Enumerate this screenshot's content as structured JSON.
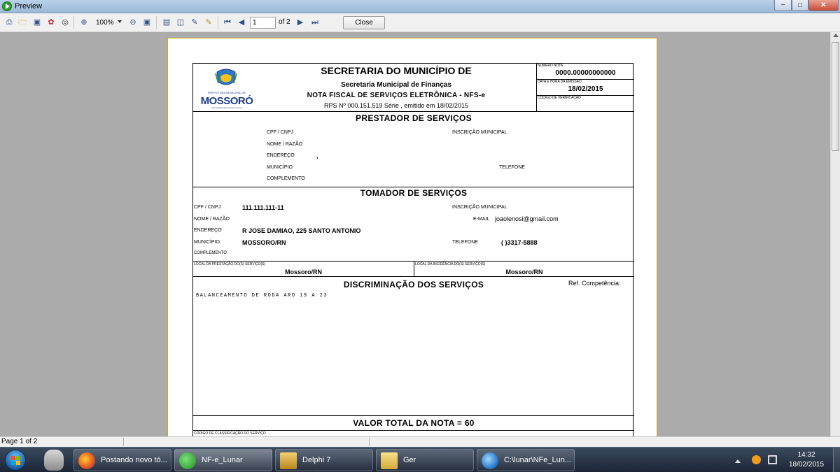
{
  "window": {
    "title": "Preview",
    "min": "−",
    "max": "□",
    "close": "✕"
  },
  "toolbar": {
    "zoom": "100%",
    "page_current": "1",
    "page_total": "of 2",
    "close_label": "Close"
  },
  "doc": {
    "header": {
      "title": "SECRETARIA DO MUNICÍPIO DE",
      "sub1": "Secretaria Municipal de Finanças",
      "sub2": "NOTA FISCAL DE SERVIÇOS ELETRÔNICA - NFS-e",
      "sub3": "RPS Nº 000.151.519 Série , emitido em 18/02/2015",
      "logo_text": "MOSSORÓ",
      "logo_small": "PREFEITURA MUNICIPAL DE",
      "logo_under": "www.prefeiturademossoro.com.br",
      "numero_label": "NÚMERO NOTA",
      "numero_value": "0000.00000000000",
      "data_label": "DATA E HORA DA EMISSÃO",
      "data_value": "18/02/2015",
      "codigo_label": "CÓDIGO DE VERIFICAÇÃO"
    },
    "prestador": {
      "title": "PRESTADOR DE SERVIÇOS",
      "cpf_label": "CPF / CNPJ",
      "nome_label": "NOME / RAZÃO",
      "endereco_label": "ENDEREÇO",
      "endereco_value": ",",
      "municipio_label": "MUNICÍPIO",
      "complemento_label": "COMPLEMENTO",
      "inscricao_label": "INSCRIÇÃO MUNICIPAL",
      "telefone_label": "TELEFONE"
    },
    "tomador": {
      "title": "TOMADOR DE SERVIÇOS",
      "cpf_label": "CPF / CNPJ",
      "cpf_value": "111.111.111-11",
      "nome_label": "NOME / RAZÃO",
      "endereco_label": "ENDEREÇO",
      "endereco_value": "R JOSE DAMIAO, 225 SANTO ANTONIO",
      "municipio_label": "MUNICÍPIO",
      "municipio_value": "MOSSORO/RN",
      "complemento_label": "COMPLEMENTO",
      "inscricao_label": "INSCRIÇÃO MUNICIPAL",
      "email_label": "E-MAIL",
      "email_value": "joaolenosi@gmail.com",
      "telefone_label": "TELEFONE",
      "telefone_value": "(    )3317-5888"
    },
    "local": {
      "prestacao_label": "LOCAL DA PRESTAÇÃO DO(S) SERVIÇO(S)",
      "prestacao_value": "Mossoro/RN",
      "incidencia_label": "LOCAL DA INCIDÊNCIA DO(S) SERVIÇO(S)",
      "incidencia_value": "Mossoro/RN"
    },
    "discriminacao": {
      "title": "DISCRIMINAÇÃO DOS SERVIÇOS",
      "ref_label": "Ref. Competência:",
      "text": "BALANCEAMENTO DE RODA ARO 19 A 23"
    },
    "total": {
      "label": "VALOR TOTAL DA NOTA = 60"
    },
    "classificacao_label": "CÓDIGO DE CLASSIFICAÇÃO DO SERVIÇO"
  },
  "statusbar": {
    "page": "Page 1 of 2"
  },
  "taskbar": {
    "items": [
      {
        "label": "Postando novo tó..."
      },
      {
        "label": "NF-e_Lunar"
      },
      {
        "label": "Delphi 7"
      },
      {
        "label": "Ger"
      },
      {
        "label": "C:\\lunar\\NFe_Lun..."
      }
    ],
    "clock_time": "14:32",
    "clock_date": "18/02/2015"
  },
  "colors": {
    "accent": "#1b3d8c",
    "page_border": "#d9a520",
    "taskbar": "#1c2636"
  }
}
